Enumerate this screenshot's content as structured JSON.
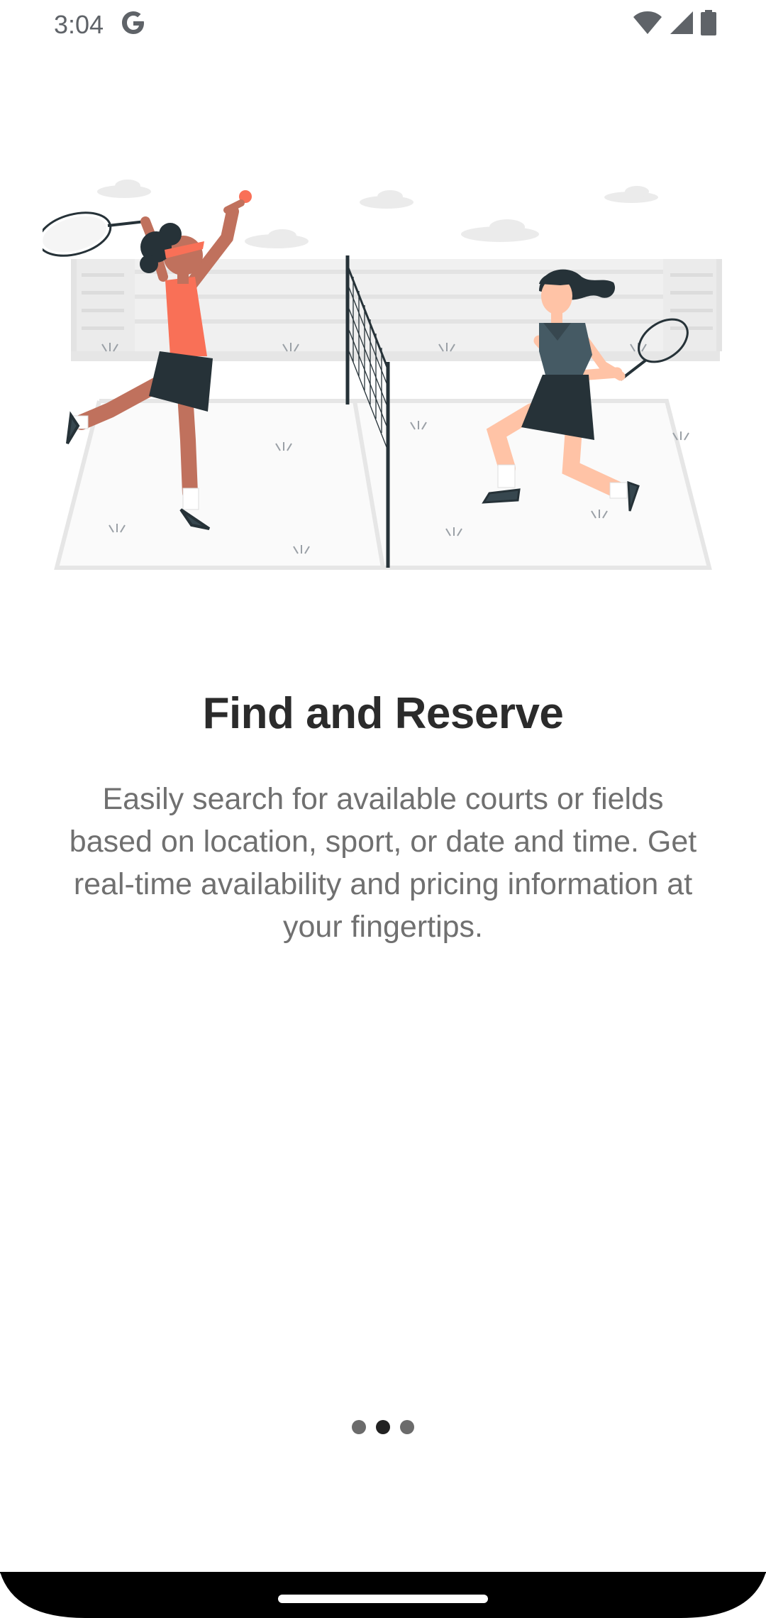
{
  "status_bar": {
    "time": "3:04",
    "icons": [
      "google-icon",
      "wifi-icon",
      "cell-signal-icon",
      "battery-icon"
    ]
  },
  "onboarding": {
    "illustration": "tennis-players-illustration",
    "title": "Find and Reserve",
    "description": "Easily search for available courts or fields based on location, sport, or date and time. Get real-time availability and pricing information at your fingertips."
  },
  "pager": {
    "total_pages": 3,
    "current_page": 2
  },
  "colors": {
    "accent": "#f97057",
    "dark": "#263238",
    "title": "#2b2b2b",
    "body_text": "#707070",
    "court_line": "#e6e6e6"
  }
}
